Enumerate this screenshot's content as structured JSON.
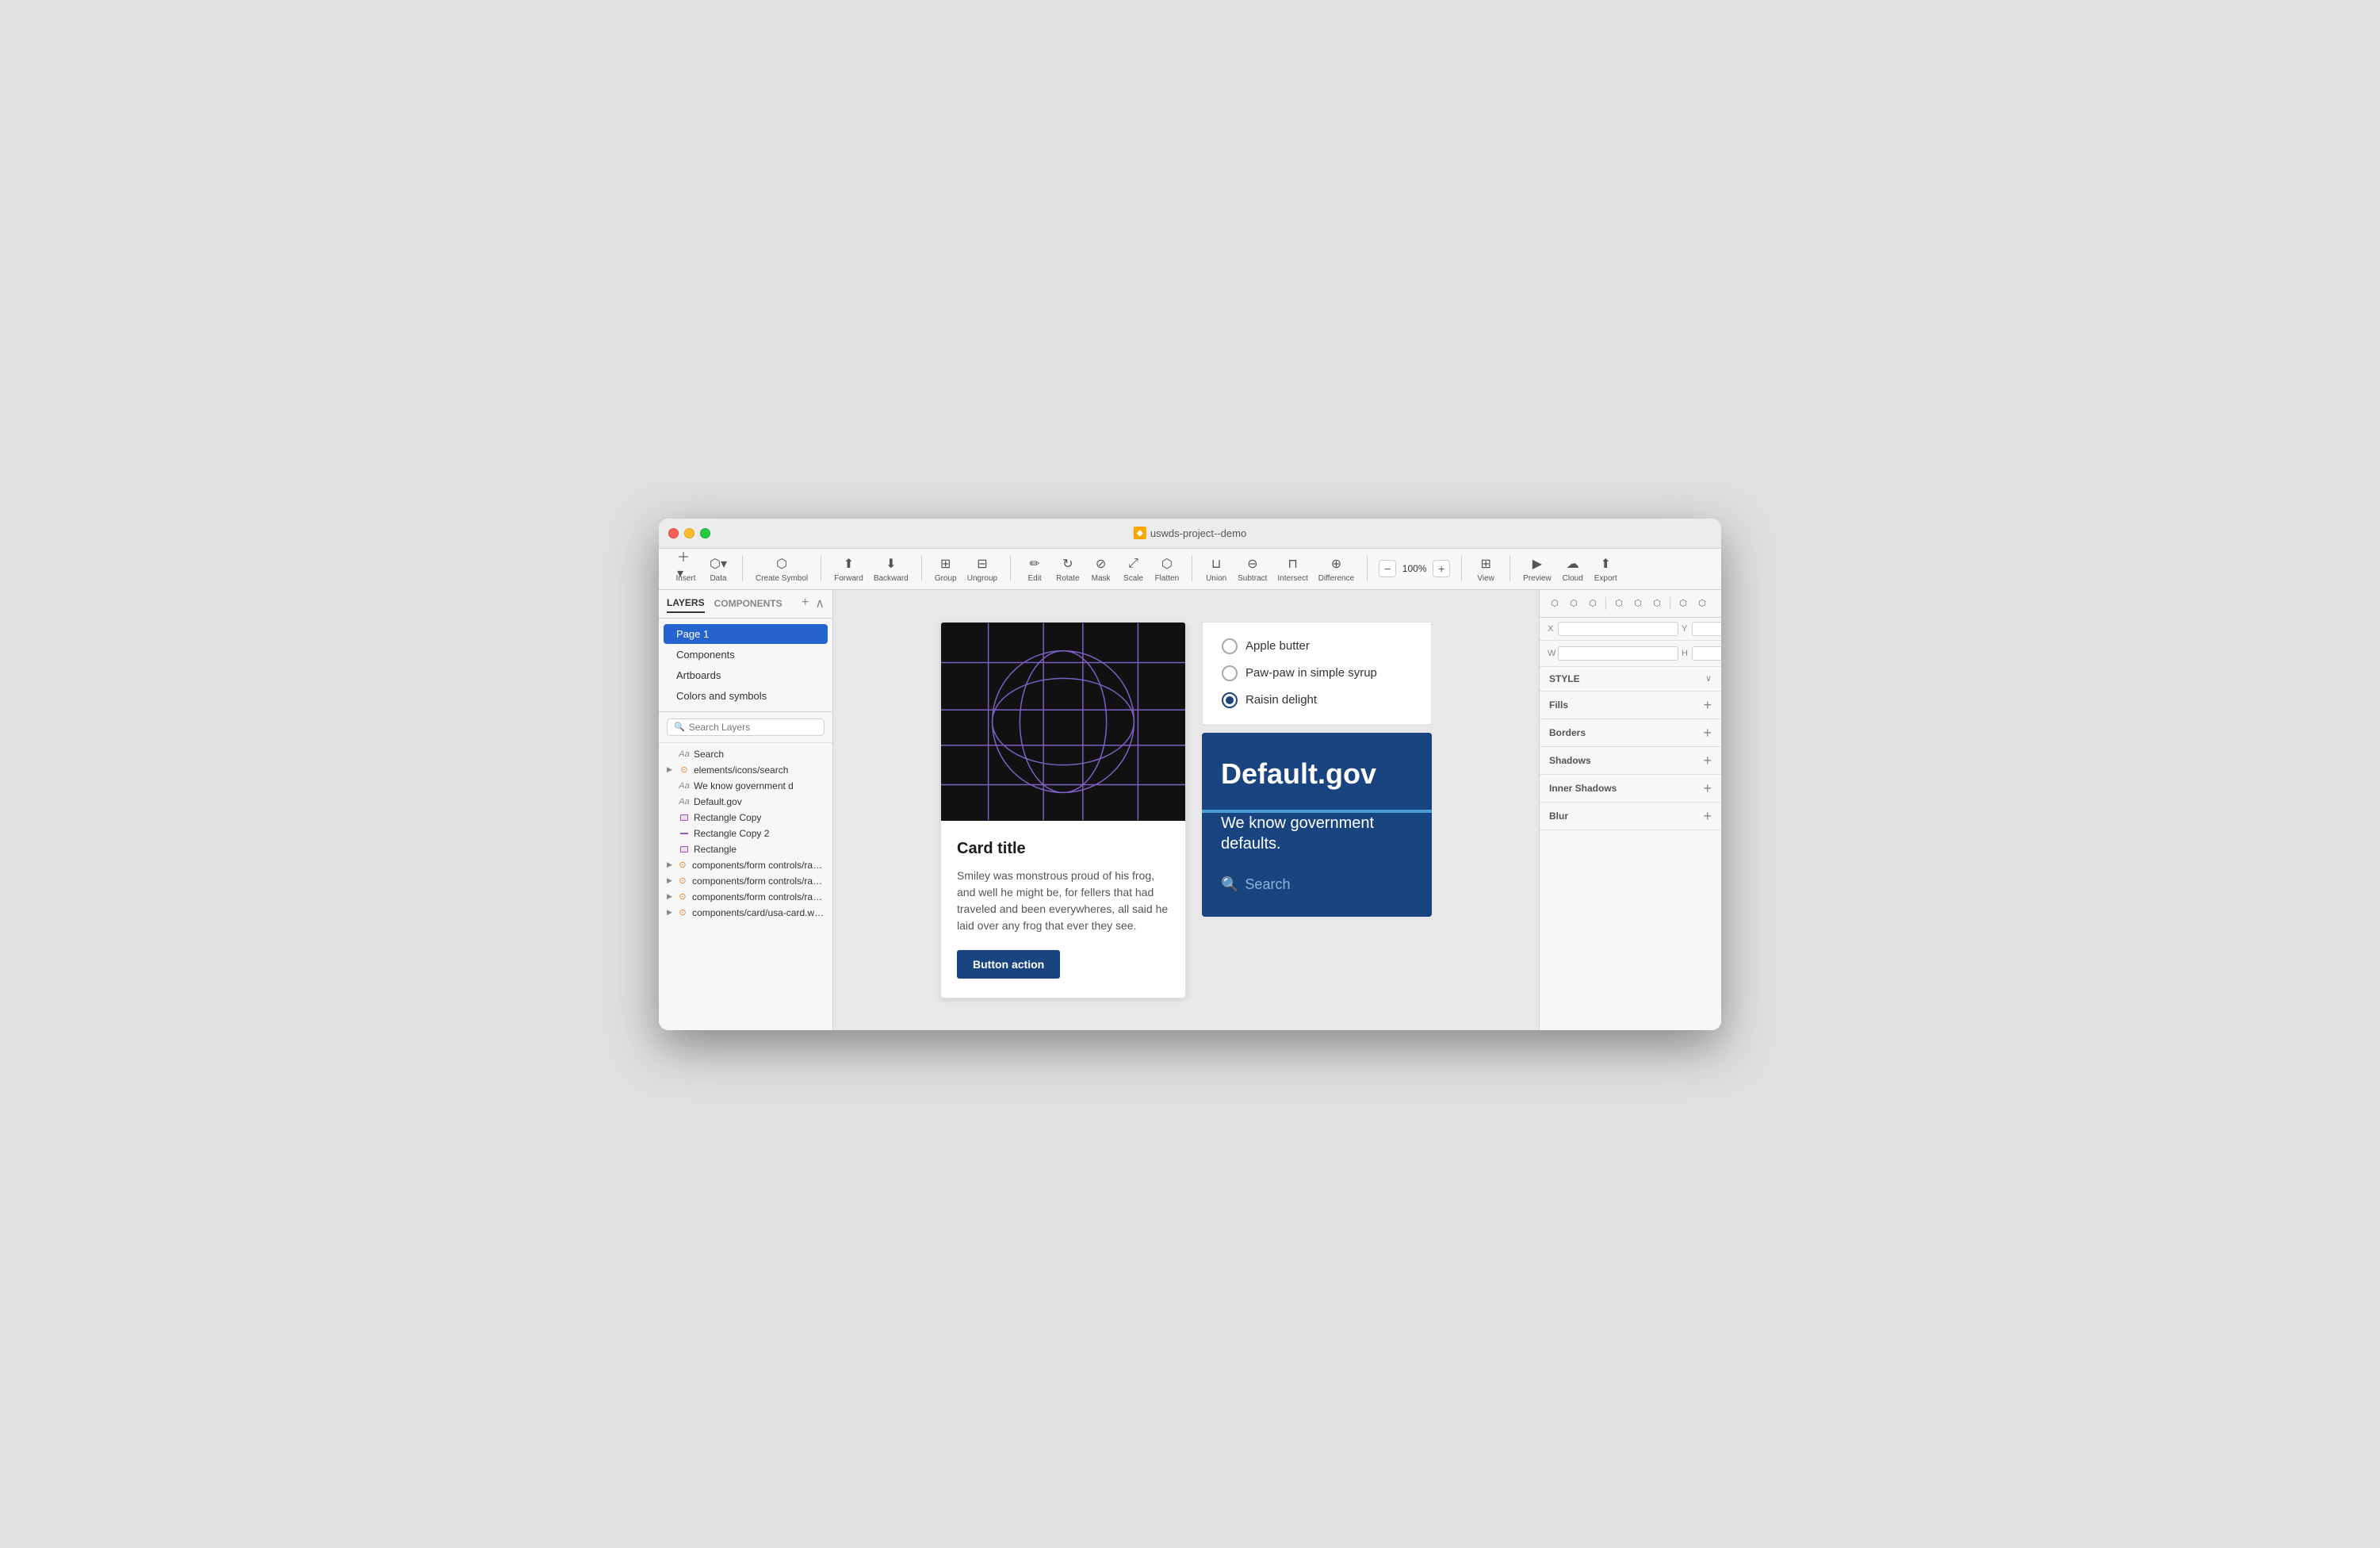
{
  "window": {
    "title": "uswds-project--demo",
    "titleIcon": "◆"
  },
  "toolbar": {
    "insert_label": "Insert",
    "data_label": "Data",
    "create_symbol_label": "Create Symbol",
    "forward_label": "Forward",
    "backward_label": "Backward",
    "group_label": "Group",
    "ungroup_label": "Ungroup",
    "edit_label": "Edit",
    "rotate_label": "Rotate",
    "mask_label": "Mask",
    "scale_label": "Scale",
    "flatten_label": "Flatten",
    "union_label": "Union",
    "subtract_label": "Subtract",
    "intersect_label": "Intersect",
    "difference_label": "Difference",
    "zoom_value": "100%",
    "zoom_minus": "−",
    "zoom_plus": "+",
    "view_label": "View",
    "preview_label": "Preview",
    "cloud_label": "Cloud",
    "export_label": "Export"
  },
  "sidebar": {
    "tabs": [
      {
        "label": "LAYERS"
      },
      {
        "label": "COMPONENTS"
      }
    ],
    "pages": [
      {
        "label": "Page 1"
      },
      {
        "label": "Components"
      },
      {
        "label": "Artboards"
      },
      {
        "label": "Colors and symbols"
      }
    ],
    "search_placeholder": "Search Layers",
    "layers": [
      {
        "type": "text",
        "indent": 0,
        "name": "Search",
        "icon": "Aa"
      },
      {
        "type": "component",
        "indent": 0,
        "name": "elements/icons/search",
        "icon": "⟳",
        "expandable": true
      },
      {
        "type": "text",
        "indent": 0,
        "name": "We know government d",
        "icon": "Aa"
      },
      {
        "type": "text",
        "indent": 0,
        "name": "Default.gov",
        "icon": "Aa"
      },
      {
        "type": "rect",
        "indent": 0,
        "name": "Rectangle Copy",
        "icon": "rect"
      },
      {
        "type": "rect-line",
        "indent": 0,
        "name": "Rectangle Copy 2",
        "icon": "line"
      },
      {
        "type": "rect",
        "indent": 0,
        "name": "Rectangle",
        "icon": "rect"
      },
      {
        "type": "component",
        "indent": 0,
        "name": "components/form controls/radio butto...",
        "icon": "⟳",
        "expandable": true
      },
      {
        "type": "component",
        "indent": 0,
        "name": "components/form controls/radio butto...",
        "icon": "⟳",
        "expandable": true
      },
      {
        "type": "component",
        "indent": 0,
        "name": "components/form controls/radio butto...",
        "icon": "⟳",
        "expandable": true
      },
      {
        "type": "component",
        "indent": 0,
        "name": "components/card/usa-card.with-medi...",
        "icon": "⟳",
        "expandable": true
      }
    ]
  },
  "canvas": {
    "card": {
      "title": "Card title",
      "body": "Smiley was monstrous proud of his frog, and well he might be, for fellers that had traveled and been everywheres, all said he laid over any frog that ever they see.",
      "button_label": "Button action"
    },
    "radio_group": {
      "options": [
        {
          "label": "Apple butter",
          "selected": false
        },
        {
          "label": "Paw-paw in simple syrup",
          "selected": false
        },
        {
          "label": "Raisin delight",
          "selected": true
        }
      ]
    },
    "gov_card": {
      "title": "Default.gov",
      "subtitle": "We know government defaults.",
      "search_label": "Search"
    }
  },
  "inspector": {
    "style_label": "STYLE",
    "fills_label": "Fills",
    "borders_label": "Borders",
    "shadows_label": "Shadows",
    "inner_shadows_label": "Inner Shadows",
    "blur_label": "Blur"
  },
  "colors": {
    "gov_blue": "#1a4480",
    "accent_blue": "#4a9fd4",
    "card_btn": "#1a4480",
    "selected_blue": "#2564CF"
  }
}
